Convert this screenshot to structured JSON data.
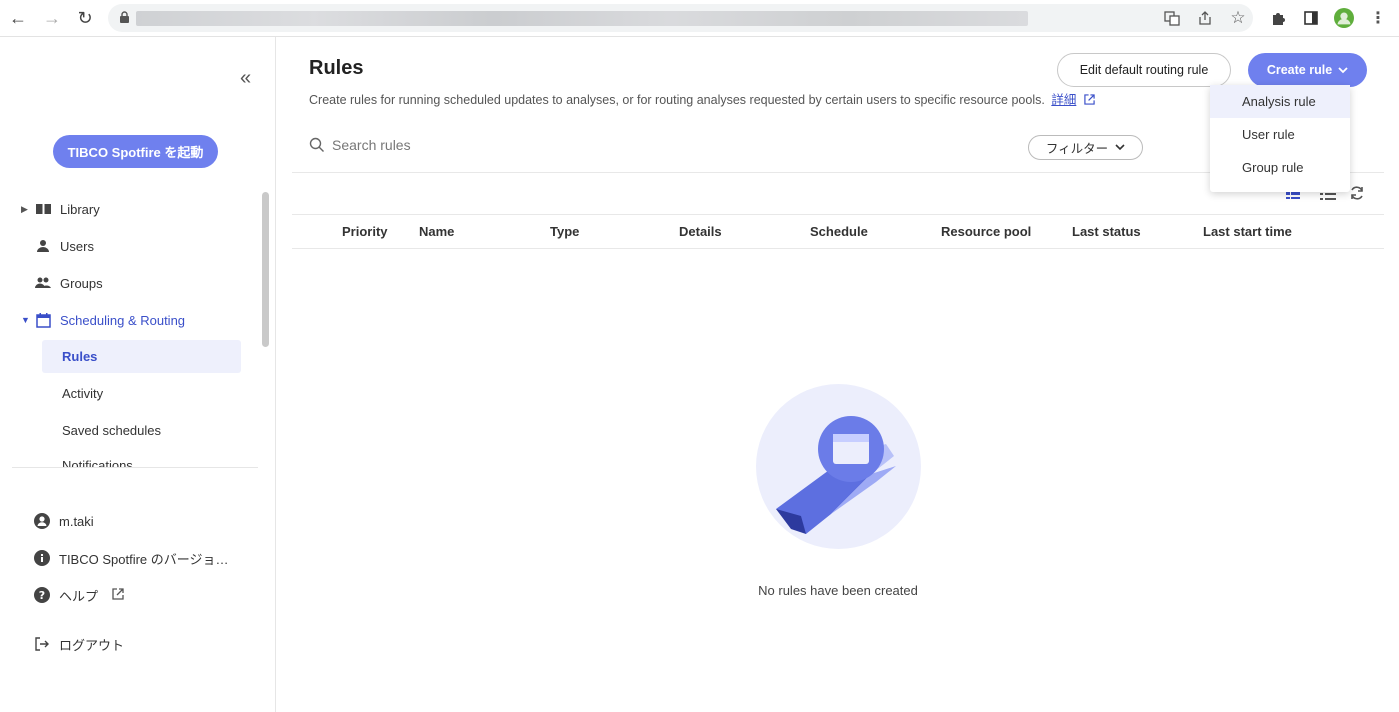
{
  "sidebar": {
    "launch_label": "TIBCO Spotfire を起動",
    "nav": {
      "library": "Library",
      "users": "Users",
      "groups": "Groups",
      "scheduling": "Scheduling & Routing"
    },
    "sub": {
      "rules": "Rules",
      "activity": "Activity",
      "saved_schedules": "Saved schedules",
      "notifications": "Notifications"
    },
    "footer": {
      "user": "m.taki",
      "version": "TIBCO Spotfire のバージョ…",
      "help": "ヘルプ",
      "logout": "ログアウト"
    }
  },
  "main": {
    "title": "Rules",
    "description": "Create rules for running scheduled updates to analyses, or for routing analyses requested by certain users to specific resource pools.",
    "details_link": "詳細",
    "edit_default_label": "Edit default routing rule",
    "create_rule_label": "Create rule",
    "search_placeholder": "Search rules",
    "filter_label": "フィルター",
    "columns": [
      "Priority",
      "Name",
      "Type",
      "Details",
      "Schedule",
      "Resource pool",
      "Last status",
      "Last start time"
    ],
    "empty_text": "No rules have been created"
  },
  "menu": {
    "items": [
      "Analysis rule",
      "User rule",
      "Group rule"
    ]
  },
  "colors": {
    "accent": "#6f80ee",
    "accent_text": "#3a4fc9",
    "selected_bg": "#eef0fc"
  }
}
